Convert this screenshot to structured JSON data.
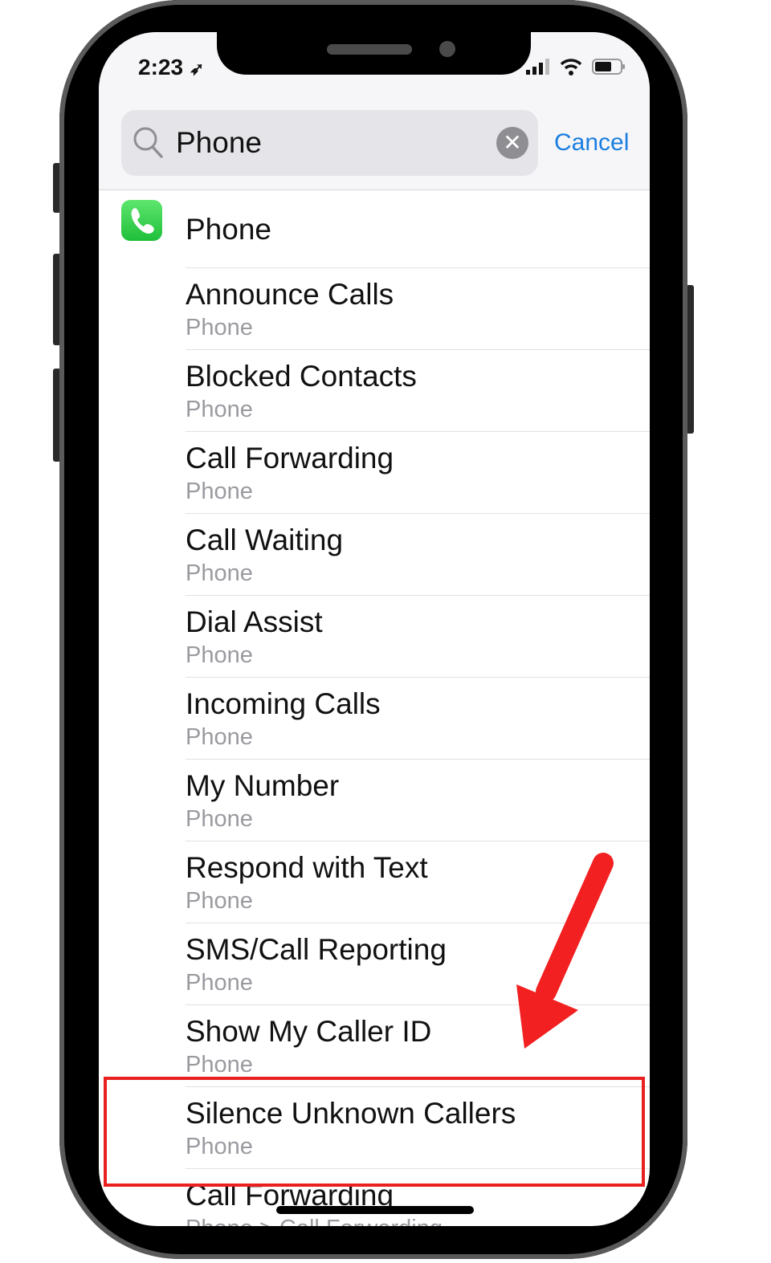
{
  "status_bar": {
    "time": "2:23",
    "icons": [
      "location-arrow-icon",
      "signal-icon",
      "wifi-icon",
      "battery-icon"
    ]
  },
  "search": {
    "value": "Phone",
    "cancel_label": "Cancel"
  },
  "app_result": {
    "label": "Phone",
    "icon": "phone-app-icon",
    "icon_color": "#34c759"
  },
  "results": [
    {
      "title": "Announce Calls",
      "subtitle": "Phone"
    },
    {
      "title": "Blocked Contacts",
      "subtitle": "Phone"
    },
    {
      "title": "Call Forwarding",
      "subtitle": "Phone"
    },
    {
      "title": "Call Waiting",
      "subtitle": "Phone"
    },
    {
      "title": "Dial Assist",
      "subtitle": "Phone"
    },
    {
      "title": "Incoming Calls",
      "subtitle": "Phone"
    },
    {
      "title": "My Number",
      "subtitle": "Phone"
    },
    {
      "title": "Respond with Text",
      "subtitle": "Phone"
    },
    {
      "title": "SMS/Call Reporting",
      "subtitle": "Phone"
    },
    {
      "title": "Show My Caller ID",
      "subtitle": "Phone"
    },
    {
      "title": "Silence Unknown Callers",
      "subtitle": "Phone"
    },
    {
      "title": "Call Forwarding",
      "subtitle": "Phone > Call Forwarding"
    }
  ],
  "annotation": {
    "highlighted_item": "Silence Unknown Callers",
    "color": "#e8201f"
  },
  "colors": {
    "accent": "#1a7ee0",
    "subtitle": "#9a9aa0"
  }
}
